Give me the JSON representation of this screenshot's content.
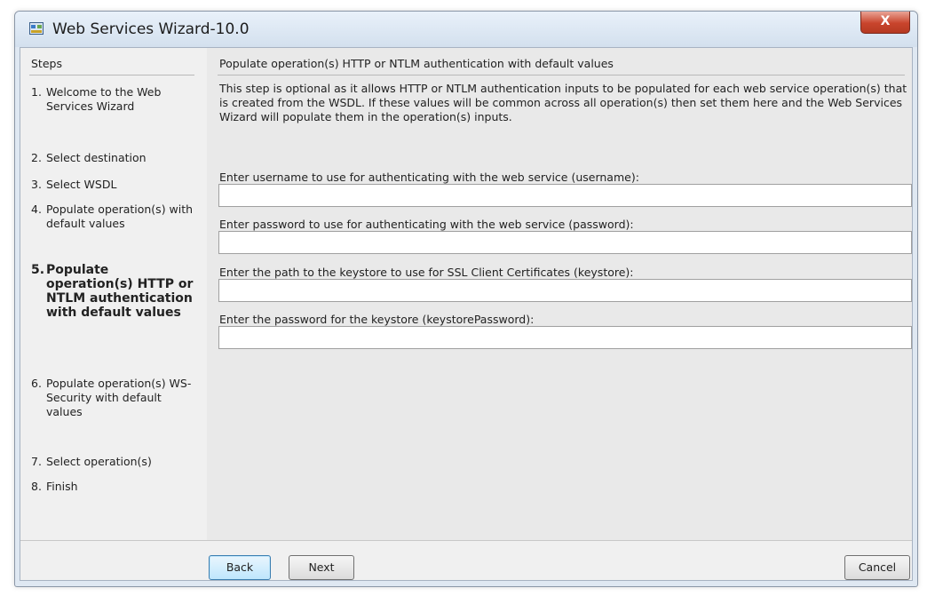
{
  "window": {
    "title": "Web Services Wizard-10.0",
    "close_label": "X"
  },
  "steps": {
    "header": "Steps",
    "items": [
      {
        "num": "1.",
        "label": "Welcome to the Web Services Wizard"
      },
      {
        "num": "2.",
        "label": "Select destination"
      },
      {
        "num": "3.",
        "label": "Select WSDL"
      },
      {
        "num": "4.",
        "label": "Populate operation(s) with default values"
      },
      {
        "num": "5.",
        "label": "Populate operation(s) HTTP or NTLM authentication with default values"
      },
      {
        "num": "6.",
        "label": "Populate operation(s) WS-Security with default values"
      },
      {
        "num": "7.",
        "label": "Select operation(s)"
      },
      {
        "num": "8.",
        "label": "Finish"
      }
    ],
    "active_index": 4
  },
  "content": {
    "title": "Populate operation(s) HTTP or NTLM authentication with default values",
    "description": "This step is optional as it allows HTTP or NTLM authentication inputs  to be populated for each web service operation(s) that is created from the WSDL. If these values will be common across all operation(s) then set them here and the Web Services Wizard will populate them in the operation(s) inputs.",
    "fields": [
      {
        "label": "Enter username to use for authenticating with the web service (username):",
        "value": ""
      },
      {
        "label": "Enter password to use for authenticating with the web service (password):",
        "value": ""
      },
      {
        "label": "Enter the path to the keystore to use for SSL Client Certificates (keystore):",
        "value": ""
      },
      {
        "label": "Enter the password for the keystore (keystorePassword):",
        "value": ""
      }
    ]
  },
  "buttons": {
    "back": "Back",
    "next": "Next",
    "cancel": "Cancel"
  }
}
